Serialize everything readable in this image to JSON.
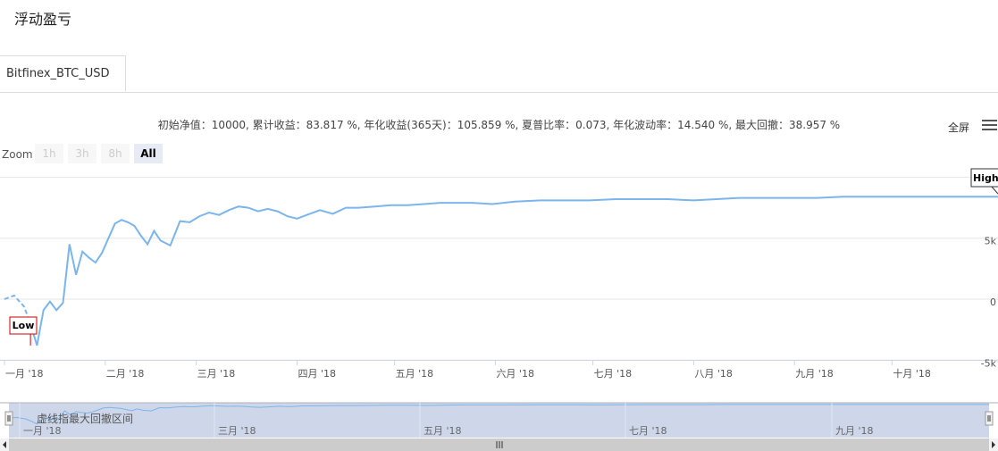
{
  "page": {
    "title": "浮动盈亏"
  },
  "tabs": [
    {
      "label": "Bitfinex_BTC_USD",
      "active": true
    }
  ],
  "stats": {
    "text": "初始净值：10000, 累计收益：83.817 %, 年化收益(365天)：105.859 %, 夏普比率：0.073, 年化波动率：14.540 %, 最大回撤：38.957 %"
  },
  "toolbar": {
    "fullscreen_label": "全屏",
    "menu_icon": "hamburger-menu-icon"
  },
  "zoom": {
    "label": "Zoom",
    "buttons": [
      {
        "label": "1h",
        "active": false
      },
      {
        "label": "3h",
        "active": false
      },
      {
        "label": "8h",
        "active": false
      },
      {
        "label": "All",
        "active": true
      }
    ]
  },
  "colors": {
    "line": "#7cb5ec",
    "navigator_mask": "#c9d3e8",
    "low_border": "#cc0000",
    "high_border": "#333333"
  },
  "chart_data": {
    "type": "line",
    "x_axis_type": "datetime",
    "x_ticks": [
      "一月 '18",
      "二月 '18",
      "三月 '18",
      "四月 '18",
      "五月 '18",
      "六月 '18",
      "七月 '18",
      "八月 '18",
      "九月 '18",
      "十月 '18"
    ],
    "y_ticks": [
      "-5k",
      "0",
      "5k"
    ],
    "ylim": [
      -5000,
      10000
    ],
    "flags": {
      "low": "Low",
      "high": "High"
    },
    "annotation": "虚线指最大回撤区间",
    "navigator_ticks": [
      "一月 '18",
      "三月 '18",
      "五月 '18",
      "七月 '18",
      "九月 '18"
    ],
    "series": [
      {
        "x": [
          "2018-01-01",
          "2018-01-04",
          "2018-01-07",
          "2018-01-09",
          "2018-01-11",
          "2018-01-13",
          "2018-01-15",
          "2018-01-17",
          "2018-01-19",
          "2018-01-21",
          "2018-01-23",
          "2018-01-25",
          "2018-01-27",
          "2018-01-29",
          "2018-01-31",
          "2018-02-02",
          "2018-02-04",
          "2018-02-06",
          "2018-02-08",
          "2018-02-10",
          "2018-02-12",
          "2018-02-14",
          "2018-02-16",
          "2018-02-18",
          "2018-02-21",
          "2018-02-24",
          "2018-02-27",
          "2018-03-02",
          "2018-03-05",
          "2018-03-08",
          "2018-03-11",
          "2018-03-14",
          "2018-03-17",
          "2018-03-20",
          "2018-03-23",
          "2018-03-26",
          "2018-03-29",
          "2018-04-01",
          "2018-04-04",
          "2018-04-08",
          "2018-04-12",
          "2018-04-16",
          "2018-04-20",
          "2018-04-25",
          "2018-04-30",
          "2018-05-05",
          "2018-05-10",
          "2018-05-15",
          "2018-05-20",
          "2018-05-25",
          "2018-05-31",
          "2018-06-07",
          "2018-06-15",
          "2018-06-22",
          "2018-06-30",
          "2018-07-08",
          "2018-07-16",
          "2018-07-24",
          "2018-08-01",
          "2018-08-08",
          "2018-08-15",
          "2018-08-22",
          "2018-08-31",
          "2018-09-08",
          "2018-09-16",
          "2018-09-24",
          "2018-10-02",
          "2018-10-10",
          "2018-10-20",
          "2018-10-30"
        ],
        "values": [
          0,
          300,
          -600,
          -2000,
          -3800,
          -900,
          -200,
          -900,
          -300,
          4500,
          2000,
          3900,
          3400,
          3000,
          3800,
          5000,
          6200,
          6500,
          6300,
          6000,
          5200,
          4500,
          5600,
          4800,
          4400,
          6400,
          6300,
          6800,
          7100,
          6900,
          7300,
          7600,
          7500,
          7200,
          7400,
          7200,
          6800,
          6600,
          6900,
          7300,
          7000,
          7500,
          7500,
          7600,
          7700,
          7700,
          7800,
          7900,
          7900,
          7900,
          7800,
          8000,
          8100,
          8100,
          8100,
          8200,
          8200,
          8200,
          8100,
          8200,
          8300,
          8300,
          8300,
          8300,
          8400,
          8400,
          8400,
          8400,
          8400,
          8400
        ],
        "drawdown_dashed_range": [
          "2018-01-01",
          "2018-01-09"
        ]
      }
    ]
  }
}
